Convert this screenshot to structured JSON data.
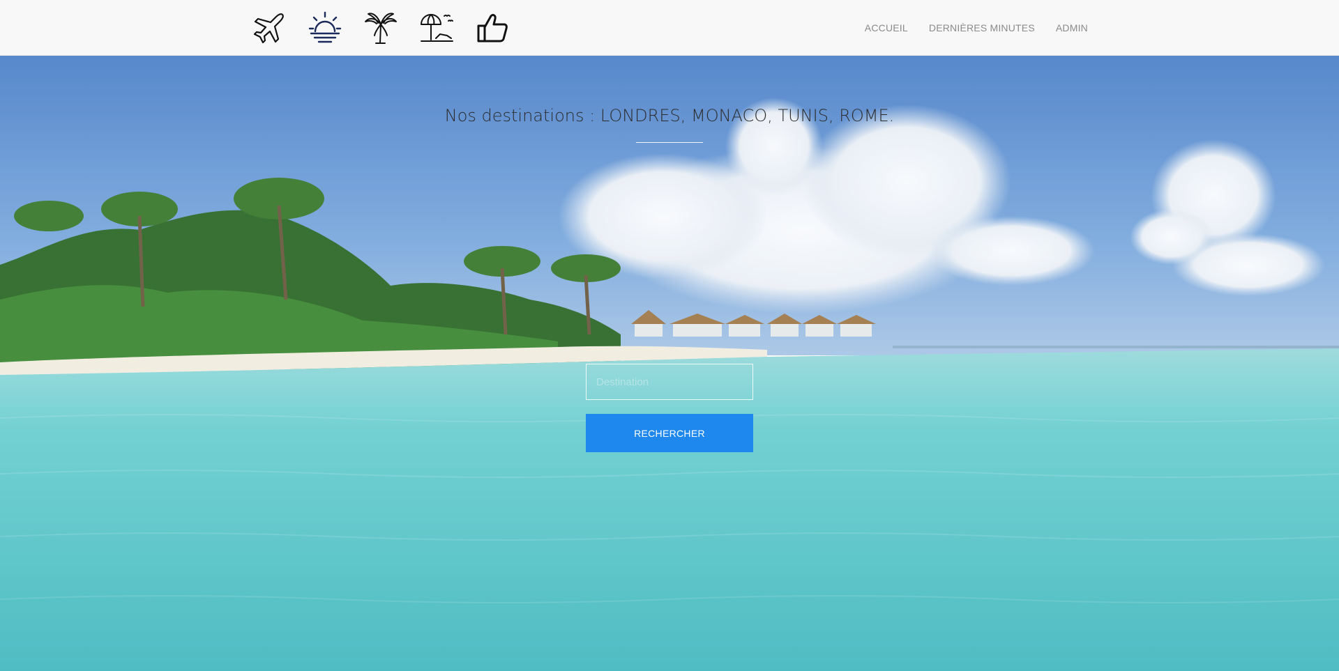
{
  "header": {
    "logo_icons": [
      "airplane-icon",
      "sunrise-icon",
      "palm-tree-icon",
      "beach-umbrella-icon",
      "thumbs-up-icon"
    ],
    "nav": [
      {
        "label": "ACCUEIL"
      },
      {
        "label": "DERNIÈRES MINUTES"
      },
      {
        "label": "ADMIN"
      }
    ]
  },
  "hero": {
    "title": "Nos destinations : LONDRES, MONACO, TUNIS, ROME.",
    "search_placeholder": "Destination",
    "search_button": "RECHERCHER",
    "background": "tropical-beach-photo"
  },
  "colors": {
    "header_bg": "#f8f8f8",
    "nav_text": "#8a8a8a",
    "button_bg": "#1e88ee",
    "sky": "#5b8fd2",
    "water": "#5fc9c9"
  }
}
